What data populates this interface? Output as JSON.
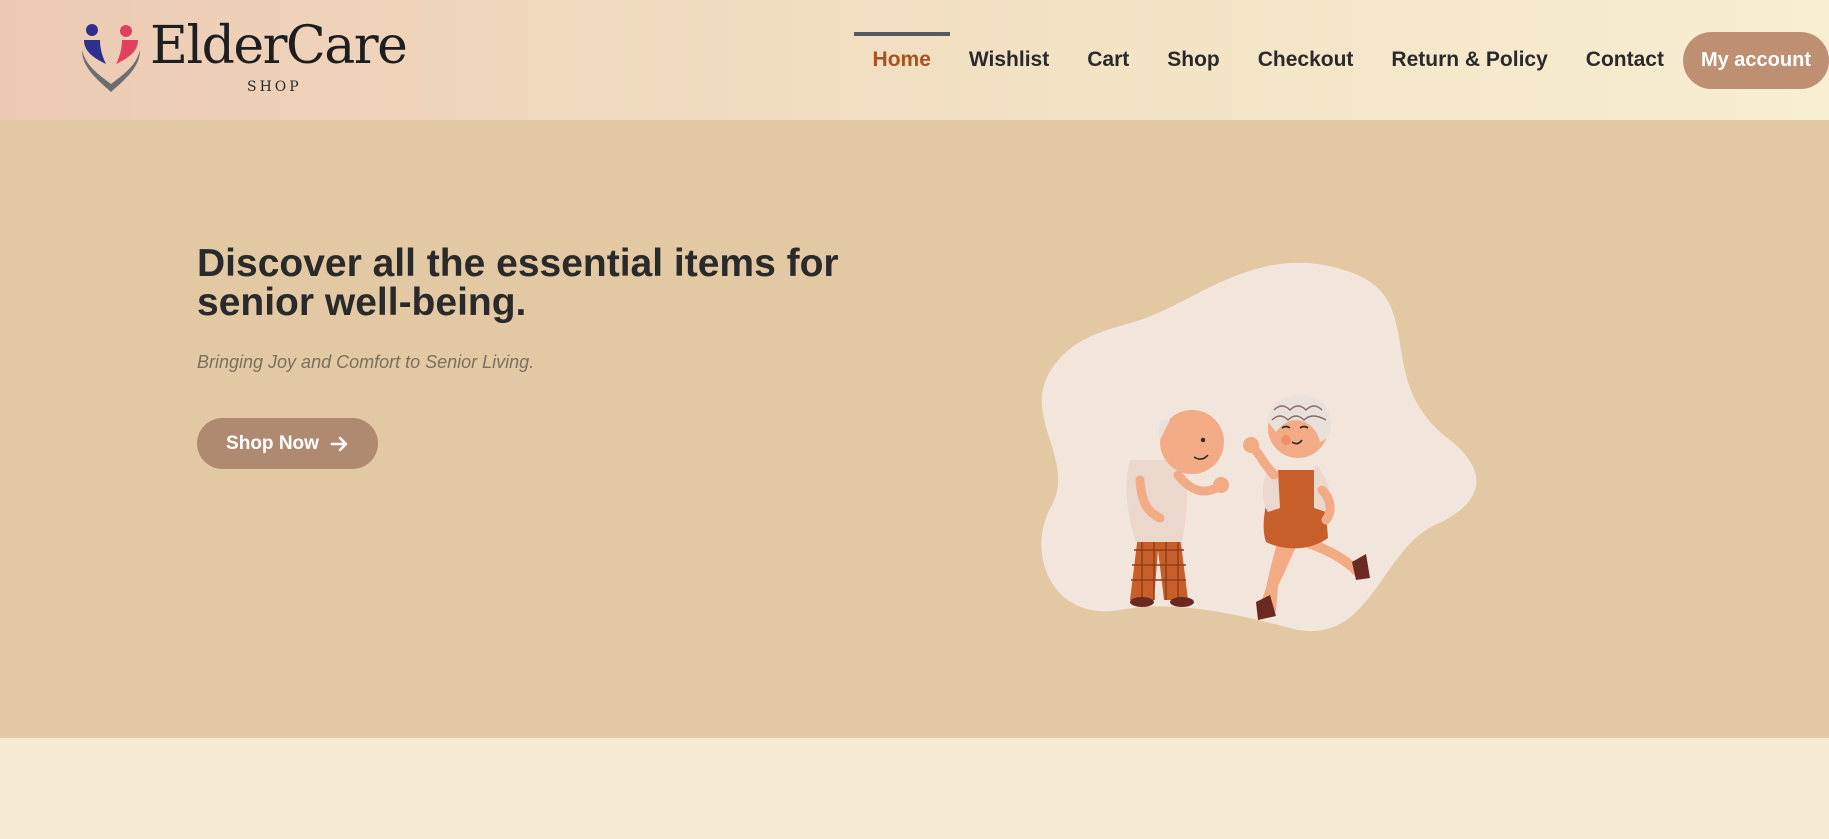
{
  "header": {
    "logo_main": "ElderCare",
    "logo_sub": "SHOP",
    "nav": [
      {
        "label": "Home",
        "active": true
      },
      {
        "label": "Wishlist"
      },
      {
        "label": "Cart"
      },
      {
        "label": "Shop"
      },
      {
        "label": "Checkout"
      },
      {
        "label": "Return & Policy"
      },
      {
        "label": "Contact"
      }
    ],
    "account_label": "My account"
  },
  "hero": {
    "title": "Discover all the essential items for senior well-being.",
    "subtitle": "Bringing Joy and Comfort to Senior Living.",
    "cta_label": "Shop Now",
    "cta_icon": "arrow-right-icon",
    "illustration": "dancing-seniors-illustration"
  },
  "colors": {
    "accent_active": "#a8521f",
    "button_bg": "#b08a70",
    "account_bg": "#bf8f72",
    "hero_bg": "#e2c8a3",
    "footer_bg": "#f5ead2"
  }
}
